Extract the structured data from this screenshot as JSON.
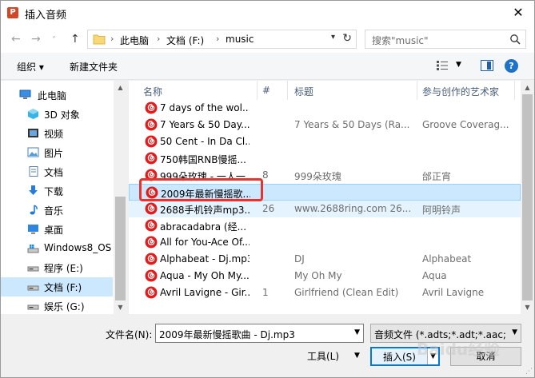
{
  "window": {
    "title": "插入音频",
    "app_icon": "P"
  },
  "nav": {
    "back_glyph": "←",
    "forward_glyph": "→",
    "recent_glyph": "˅",
    "up_glyph": "↑",
    "breadcrumb": [
      "此电脑",
      "文档 (F:)",
      "music"
    ],
    "separator": "›",
    "search_placeholder": "搜索\"music\""
  },
  "toolbar": {
    "organize": "组织 ▾",
    "new_folder": "新建文件夹",
    "help": "?"
  },
  "sidebar": {
    "items": [
      {
        "label": "此电脑",
        "icon": "computer-icon"
      },
      {
        "label": "3D 对象",
        "icon": "3d-objects-icon"
      },
      {
        "label": "视频",
        "icon": "video-icon"
      },
      {
        "label": "图片",
        "icon": "pictures-icon"
      },
      {
        "label": "文档",
        "icon": "documents-icon"
      },
      {
        "label": "下载",
        "icon": "download-icon"
      },
      {
        "label": "音乐",
        "icon": "music-icon"
      },
      {
        "label": "桌面",
        "icon": "desktop-icon"
      },
      {
        "label": "Windows8_OS",
        "icon": "drive-icon"
      },
      {
        "label": "程序 (E:)",
        "icon": "drive-icon"
      },
      {
        "label": "文档 (F:)",
        "icon": "drive-icon",
        "selected": true
      },
      {
        "label": "娱乐 (G:)",
        "icon": "drive-icon"
      }
    ]
  },
  "columns": {
    "name": "名称",
    "number": "#",
    "title": "标题",
    "artist": "参与创作的艺术家"
  },
  "files": [
    {
      "name": "7 days of the wol...",
      "number": "",
      "title": "",
      "artist": ""
    },
    {
      "name": "7 Years & 50 Day...",
      "number": "",
      "title": "7 Years & 50 Days (Ra...",
      "artist": "Groove Coverag..."
    },
    {
      "name": "50 Cent - In Da Cl...",
      "number": "",
      "title": "",
      "artist": ""
    },
    {
      "name": "750韩国RNB慢摇...",
      "number": "",
      "title": "",
      "artist": ""
    },
    {
      "name": "999朵玫瑰 - 一人一...",
      "number": "8",
      "title": "999朵玫瑰",
      "artist": "邰正宵"
    },
    {
      "name": "2009年最新慢摇歌...",
      "number": "",
      "title": "",
      "artist": "",
      "selected": true
    },
    {
      "name": "2688手机铃声mp3...",
      "number": "26",
      "title": "www.2688ring.com  26...",
      "artist": "阿明铃声",
      "hover": true
    },
    {
      "name": "abracadabra (经...",
      "number": "",
      "title": "",
      "artist": ""
    },
    {
      "name": "All for You-Ace Of...",
      "number": "",
      "title": "",
      "artist": ""
    },
    {
      "name": "Alphabeat - Dj.mp3",
      "number": "",
      "title": "DJ",
      "artist": "Alphabeat"
    },
    {
      "name": "Aqua - My Oh My...",
      "number": "",
      "title": "My Oh My",
      "artist": "Aqua"
    },
    {
      "name": "Avril Lavigne - Gir...",
      "number": "1",
      "title": "Girlfriend (Clean Edit)",
      "artist": "Avril Lavigne"
    }
  ],
  "bottom": {
    "filename_label": "文件名(N):",
    "filename_value": "2009年最新慢摇歌曲 - Dj.mp3",
    "filetype_value": "音频文件 (*.adts;*.adt;*.aac;*.aif",
    "tools_label": "工具(L)",
    "insert_label": "插入(S)",
    "cancel_label": "取消"
  },
  "watermark": "Baidu经验",
  "colors": {
    "selection": "#cce8ff",
    "hover": "#e5f3ff",
    "highlight_box": "#e8322d",
    "file_icon": "#e21c1c"
  }
}
